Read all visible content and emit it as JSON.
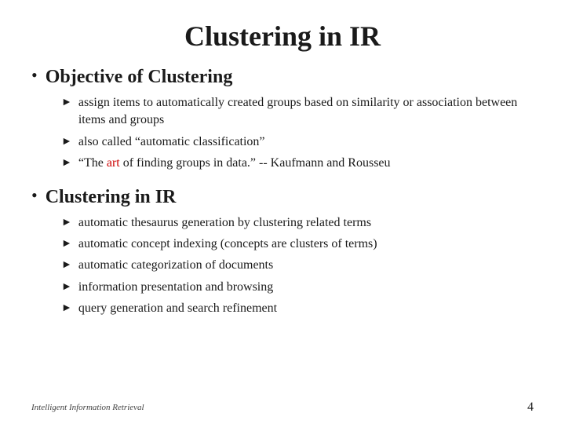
{
  "slide": {
    "title": "Clustering in IR",
    "section1": {
      "heading": "Objective of Clustering",
      "bullets": [
        {
          "text": "assign items to automatically created groups based on similarity or association between items and groups",
          "has_highlight": false
        },
        {
          "text": "also called “automatic classification”",
          "has_highlight": false
        },
        {
          "text_before": "“The ",
          "highlight": "art",
          "text_after": " of finding groups in data.”  -- Kaufmann and Rousseu",
          "has_highlight": true
        }
      ]
    },
    "section2": {
      "heading": "Clustering in IR",
      "bullets": [
        "automatic thesaurus generation by clustering related terms",
        "automatic concept indexing (concepts are clusters of terms)",
        "automatic categorization of documents",
        "information presentation and browsing",
        "query generation and search refinement"
      ]
    },
    "footer": {
      "left": "Intelligent Information Retrieval",
      "right": "4"
    }
  }
}
